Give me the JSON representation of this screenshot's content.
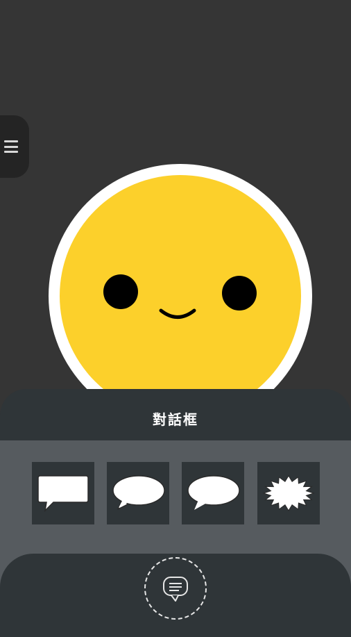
{
  "menu": {
    "icon": "hamburger-menu-icon"
  },
  "avatar": {
    "face_color": "#fcd02b",
    "outline_color": "#ffffff",
    "eye_color": "#000000"
  },
  "panel": {
    "title": "對話框",
    "bubbles": [
      {
        "icon": "rectangle-speech-bubble-icon"
      },
      {
        "icon": "oval-speech-bubble-left-tail-icon"
      },
      {
        "icon": "oval-speech-bubble-right-tail-icon"
      },
      {
        "icon": "spiky-shout-bubble-icon"
      }
    ]
  },
  "bottom": {
    "icon": "chat-message-icon"
  },
  "colors": {
    "background": "#353535",
    "panel_dark": "#2f3538",
    "panel_body": "#565b5f",
    "menu_tab": "#242424"
  }
}
